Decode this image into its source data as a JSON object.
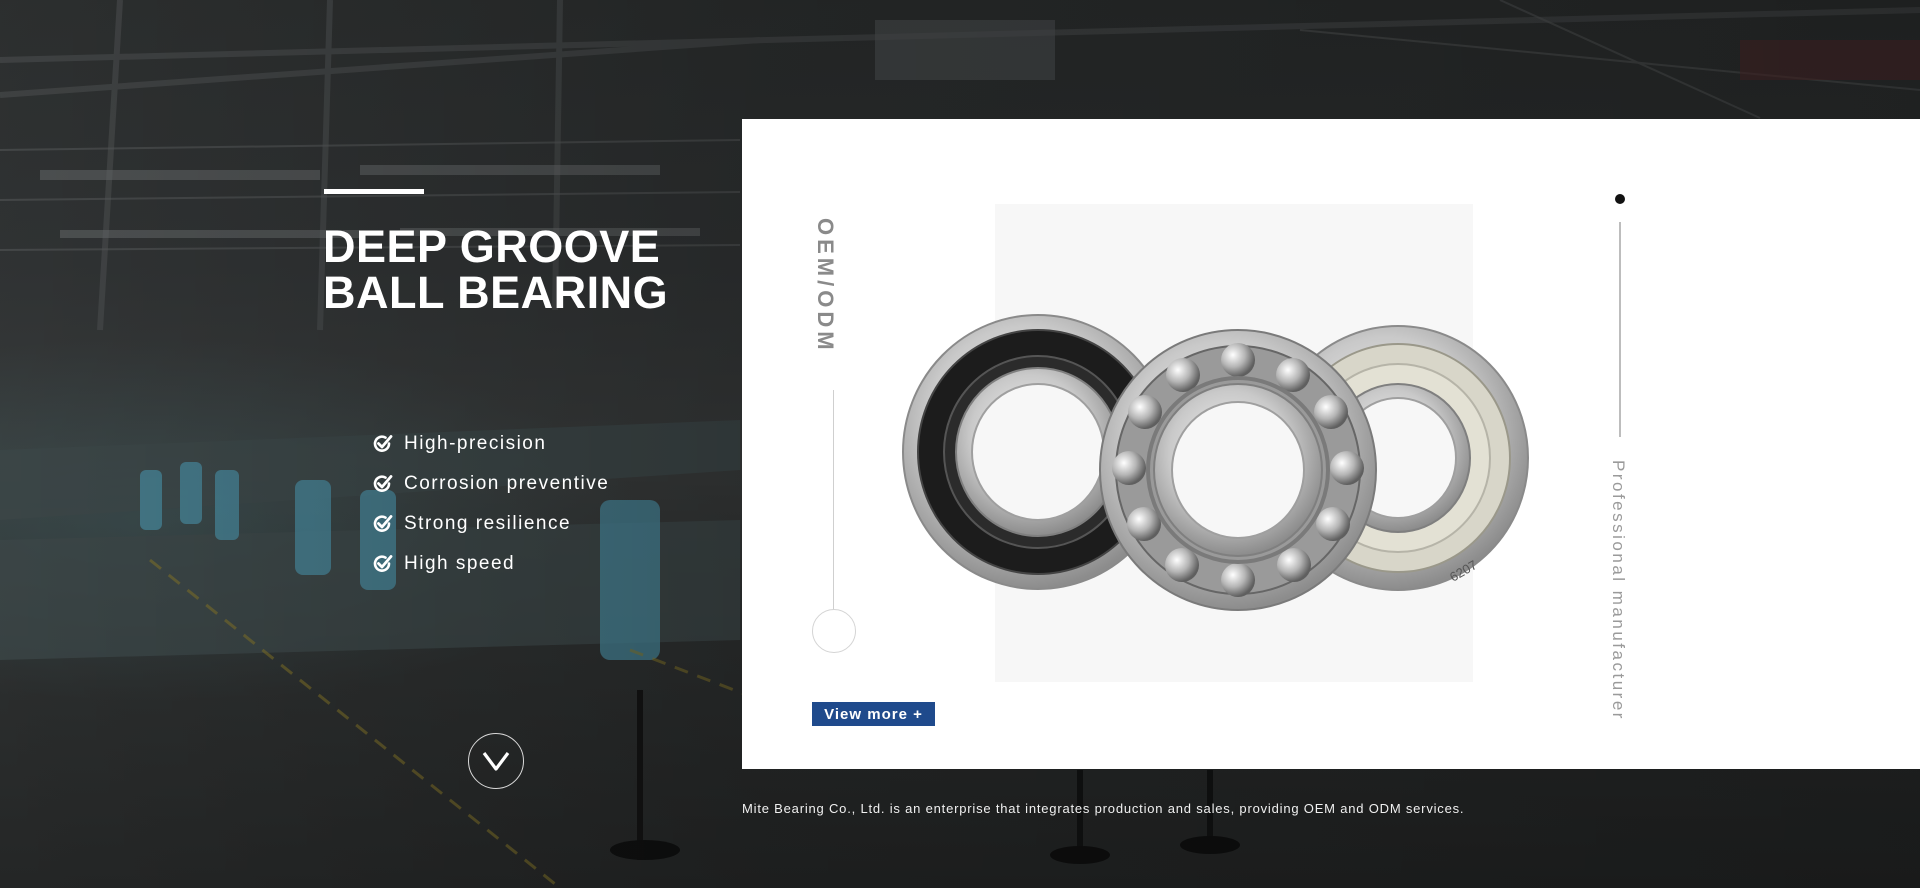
{
  "hero": {
    "title_line1": "DEEP GROOVE",
    "title_line2": "BALL BEARING",
    "features": [
      {
        "label": "High-precision",
        "icon": "check-circle-icon"
      },
      {
        "label": "Corrosion preventive",
        "icon": "check-circle-icon"
      },
      {
        "label": "Strong resilience",
        "icon": "check-circle-icon"
      },
      {
        "label": "High speed",
        "icon": "check-circle-icon"
      }
    ],
    "scroll_icon": "chevron-down-icon"
  },
  "card": {
    "side_label": "OEM/ODM",
    "product_image": "ball-bearings-product-image",
    "bearing_marking": "6207",
    "view_more_label": "View more +",
    "right_label": "Professional manufacturer"
  },
  "footer": {
    "description": "Mite Bearing Co., Ltd. is an enterprise that integrates production and sales, providing OEM and ODM services."
  },
  "colors": {
    "button_blue": "#1f4a8c",
    "title_white": "#ffffff",
    "card_white": "#ffffff"
  }
}
